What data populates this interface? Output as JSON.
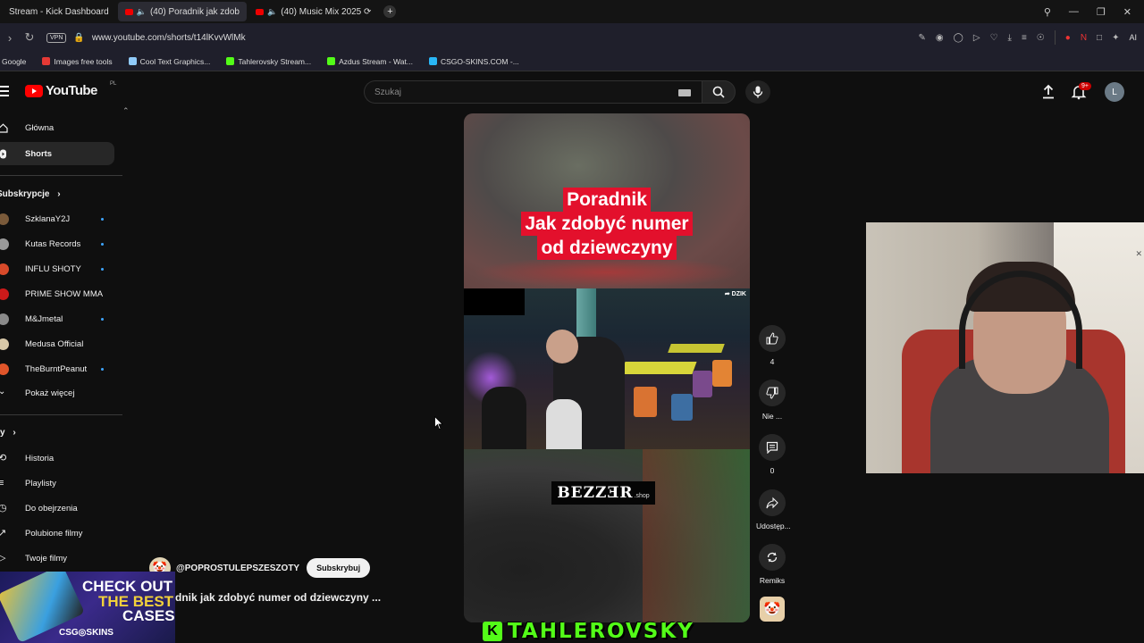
{
  "browser": {
    "tabs": [
      {
        "title": "Stream - Kick Dashboard",
        "active": false
      },
      {
        "title": "(40) Poradnik jak zdob",
        "active": true
      },
      {
        "title": "(40) Music Mix 2025 ⟳",
        "active": false
      }
    ],
    "new_tab": "+",
    "url": "www.youtube.com/shorts/t14lKvvWlMk",
    "vpn_label": "VPN",
    "ai_label": "AI",
    "bookmarks": [
      {
        "label": "Google",
        "color": "#4285f4"
      },
      {
        "label": "Images free tools",
        "color": "#e53935"
      },
      {
        "label": "Cool Text Graphics...",
        "color": "#90caf9"
      },
      {
        "label": "Tahlerovsky Stream...",
        "color": "#53fc18"
      },
      {
        "label": "Azdus Stream - Wat...",
        "color": "#53fc18"
      },
      {
        "label": "CSGO-SKINS.COM -...",
        "color": "#29b6f6"
      }
    ]
  },
  "youtube": {
    "logo_text": "YouTube",
    "region": "PL",
    "search_placeholder": "Szukaj",
    "notif_count": "9+",
    "avatar_letter": "L",
    "sidebar": {
      "main": [
        {
          "label": "Główna",
          "icon": "home-icon"
        },
        {
          "label": "Shorts",
          "icon": "shorts-icon",
          "active": true
        }
      ],
      "subs_header": "Subskrypcje",
      "subscriptions": [
        {
          "label": "SzklanaY2J",
          "color": "#7a5a3a",
          "dot": true
        },
        {
          "label": "Kutas Records",
          "color": "#9a9a9a",
          "dot": true
        },
        {
          "label": "INFLU SHOTY",
          "color": "#d84a2a",
          "dot": true
        },
        {
          "label": "PRIME SHOW MMA",
          "color": "#cc1a1a",
          "dot": false
        },
        {
          "label": "M&Jmetal",
          "color": "#8a8a8a",
          "dot": true
        },
        {
          "label": "Medusa Official",
          "color": "#d8c8a8",
          "dot": false
        },
        {
          "label": "TheBurntPeanut",
          "color": "#e0552a",
          "dot": true
        }
      ],
      "show_more": "Pokaż więcej",
      "you_header": "y",
      "you_items": [
        {
          "label": "Historia",
          "icon": "history-icon"
        },
        {
          "label": "Playlisty",
          "icon": "playlist-icon"
        },
        {
          "label": "Do obejrzenia",
          "icon": "watch-later-icon"
        },
        {
          "label": "Polubione filmy",
          "icon": "liked-icon"
        },
        {
          "label": "Twoje filmy",
          "icon": "your-videos-icon"
        }
      ]
    },
    "short": {
      "caption_lines": [
        "Poradnik",
        "Jak zdobyć numer",
        "od dziewczyny"
      ],
      "watermark": "DZIK",
      "sponsor": "BEZZƎR",
      "sponsor_suffix": ".shop",
      "channel": "@POPROSTULEPSZESZOTY",
      "subscribe": "Subskrybuj",
      "title": "dnik jak zdobyć numer od dziewczyny ...",
      "actions": [
        {
          "icon": "like-icon",
          "label": "4"
        },
        {
          "icon": "dislike-icon",
          "label": "Nie ..."
        },
        {
          "icon": "comments-icon",
          "label": "0"
        },
        {
          "icon": "share-icon",
          "label": "Udostęp..."
        },
        {
          "icon": "remix-icon",
          "label": "Remiks"
        }
      ]
    }
  },
  "overlay": {
    "ad_line1": "CHECK OUT",
    "ad_line2": "THE BEST",
    "ad_line3": "CASES",
    "ad_brand": "CSG◎SKINS",
    "kick_letter": "K",
    "kick_name": "TAHLEROVSKY"
  }
}
